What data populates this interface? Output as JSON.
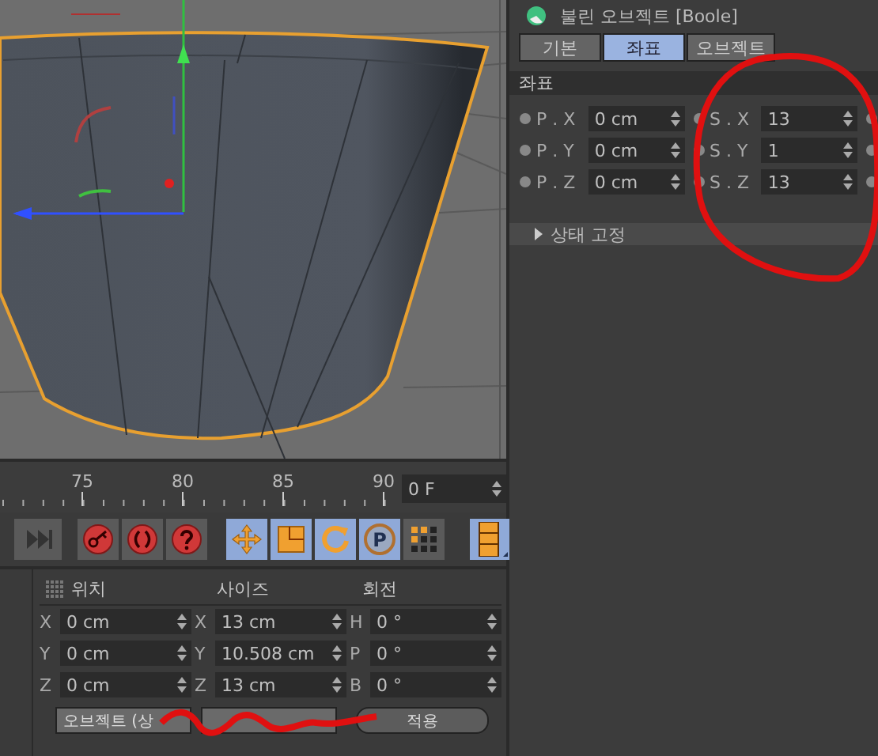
{
  "timeline": {
    "labels": [
      "75",
      "80",
      "85",
      "90"
    ],
    "frame_field": {
      "value": "0 F"
    }
  },
  "toolbar": [
    {
      "kind": "skip-end",
      "selected": false
    },
    {
      "kind": "key",
      "selected": false
    },
    {
      "kind": "record",
      "selected": false
    },
    {
      "kind": "help",
      "selected": false
    },
    {
      "kind": "move",
      "selected": true
    },
    {
      "kind": "scale",
      "selected": true
    },
    {
      "kind": "rotate",
      "selected": true
    },
    {
      "kind": "param",
      "selected": true,
      "label": "P"
    },
    {
      "kind": "grid",
      "selected": false
    },
    {
      "kind": "film",
      "selected": true
    }
  ],
  "coordinates": {
    "headers": [
      "위치",
      "사이즈",
      "회전"
    ],
    "rows": [
      [
        {
          "axis": "X",
          "value": "0 cm"
        },
        {
          "axis": "X",
          "value": "13 cm"
        },
        {
          "axis": "H",
          "value": "0 °"
        }
      ],
      [
        {
          "axis": "Y",
          "value": "0 cm"
        },
        {
          "axis": "Y",
          "value": "10.508 cm"
        },
        {
          "axis": "P",
          "value": "0 °"
        }
      ],
      [
        {
          "axis": "Z",
          "value": "0 cm"
        },
        {
          "axis": "Z",
          "value": "13 cm"
        },
        {
          "axis": "B",
          "value": "0 °"
        }
      ]
    ],
    "buttons": [
      {
        "kind": "mode",
        "label": "오브젝트 (상"
      },
      {
        "kind": "mode"
      },
      {
        "kind": "apply",
        "label": "적용"
      }
    ]
  },
  "attributes": {
    "title": "불린 오브젝트 [Boole]",
    "tabs": [
      {
        "label": "기본",
        "selected": false
      },
      {
        "label": "좌표",
        "selected": true
      },
      {
        "label": "오브젝트",
        "selected": false
      }
    ],
    "section": "좌표",
    "rows": [
      {
        "p_label": "P . X",
        "p_value": "0 cm",
        "s_label": "S . X",
        "s_value": "13"
      },
      {
        "p_label": "P . Y",
        "p_value": "0 cm",
        "s_label": "S . Y",
        "s_value": "1"
      },
      {
        "p_label": "P . Z",
        "p_value": "0 cm",
        "s_label": "S . Z",
        "s_value": "13"
      }
    ],
    "group": "상태 고정"
  }
}
